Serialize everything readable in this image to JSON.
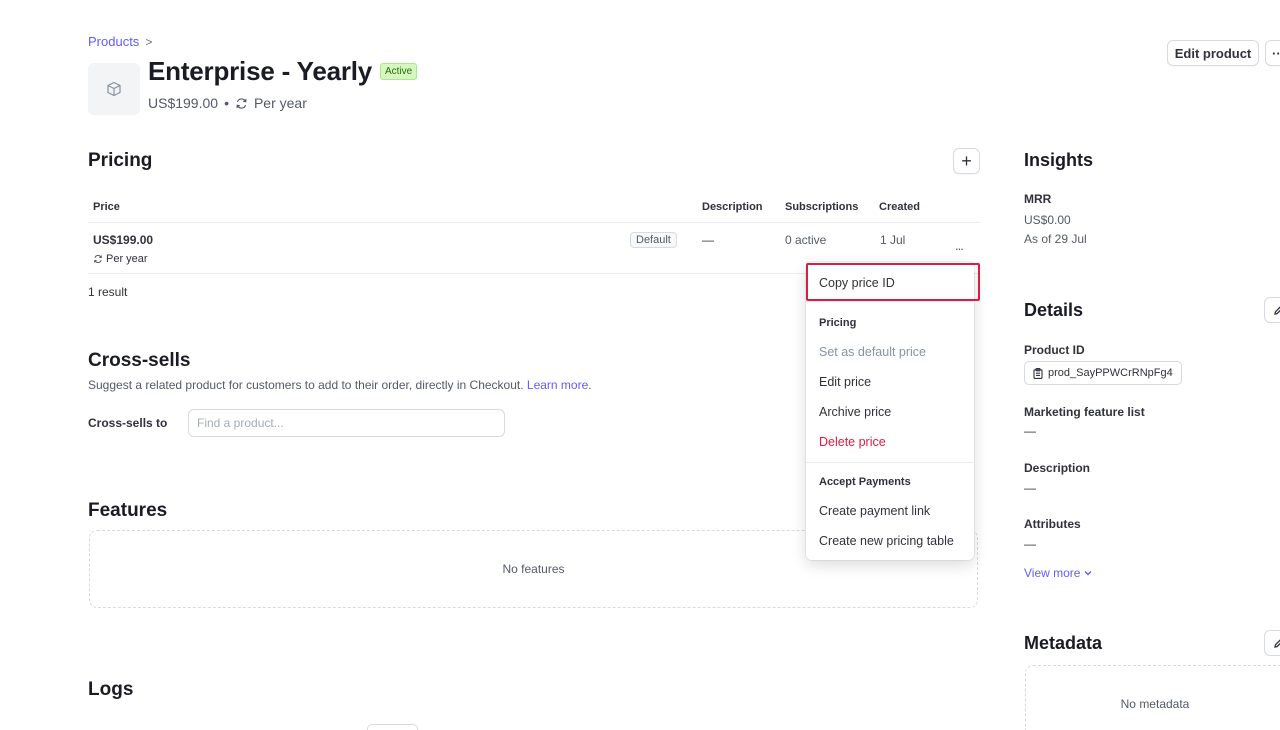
{
  "breadcrumb": {
    "label": "Products",
    "chevron": ">"
  },
  "product": {
    "name": "Enterprise - Yearly",
    "status": "Active",
    "price": "US$199.00",
    "dot": "•",
    "interval": "Per year"
  },
  "header_actions": {
    "edit_label": "Edit product",
    "more_label": "···"
  },
  "pricing": {
    "title": "Pricing",
    "add_label": "+",
    "columns": [
      "Price",
      "Description",
      "Subscriptions",
      "Created"
    ],
    "rows": [
      {
        "price": "US$199.00",
        "interval": "Per year",
        "badge": "Default",
        "description": "—",
        "subscriptions": "0 active",
        "created": "1 Jul",
        "menu": "..."
      }
    ],
    "result_count": "1 result"
  },
  "crosssells": {
    "title": "Cross-sells",
    "description": "Suggest a related product for customers to add to their order, directly in Checkout.",
    "learn_more": "Learn more",
    "field_label": "Cross-sells to",
    "placeholder": "Find a product..."
  },
  "features": {
    "title": "Features",
    "empty": "No features"
  },
  "logs": {
    "title": "Logs"
  },
  "context_menu": {
    "copy_id": "Copy price ID",
    "pricing_header": "Pricing",
    "set_default": "Set as default price",
    "edit_price": "Edit price",
    "archive_price": "Archive price",
    "delete_price": "Delete price",
    "payments_header": "Accept Payments",
    "create_link": "Create payment link",
    "create_table": "Create new pricing table"
  },
  "insights": {
    "title": "Insights",
    "mrr_label": "MRR",
    "mrr_value": "US$0.00",
    "mrr_asof": "As of 29 Jul"
  },
  "details": {
    "title": "Details",
    "product_id_label": "Product ID",
    "product_id": "prod_SayPPWCrRNpFg4",
    "marketing_label": "Marketing feature list",
    "marketing_value": "—",
    "description_label": "Description",
    "description_value": "—",
    "attributes_label": "Attributes",
    "attributes_value": "—",
    "view_more": "View more"
  },
  "metadata": {
    "title": "Metadata",
    "empty": "No metadata"
  },
  "colors": {
    "accent": "#635bff",
    "danger": "#df1b41",
    "active_green": "#217005"
  }
}
